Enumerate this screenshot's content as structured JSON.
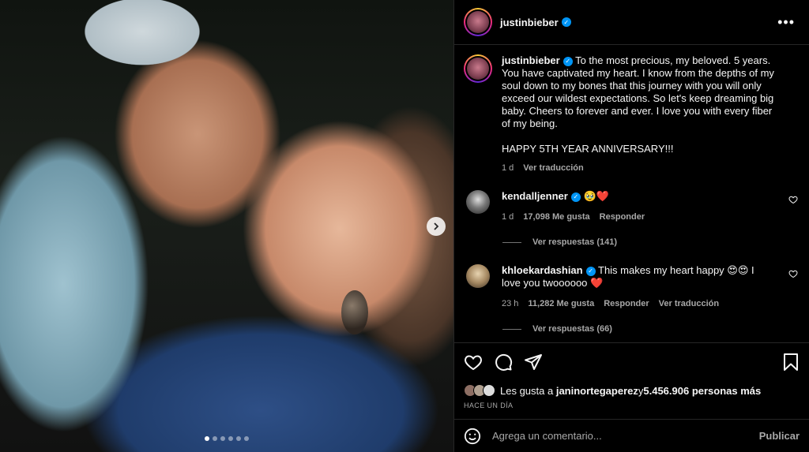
{
  "post": {
    "author": "justinbieber",
    "header_avatar_icon": "profile-avatar",
    "more_label": "•••"
  },
  "photo": {
    "carousel_dots": 6,
    "active_dot": 0,
    "next_icon": "chevron-right-icon"
  },
  "caption": {
    "username": "justinbieber",
    "text": "To the most precious, my beloved. 5 years. You have captivated my heart. I know from the depths of my soul down to my bones that this journey with you will only exceed our wildest expectations. So let's keep dreaming big baby. Cheers to forever and ever. I love you with every fiber of my being.",
    "text2": "HAPPY 5TH YEAR ANNIVERSARY!!!",
    "time": "1 d",
    "translate": "Ver traducción"
  },
  "comments": [
    {
      "username": "kendalljenner",
      "text": "🥹❤️",
      "time": "1 d",
      "likes": "17,098 Me gusta",
      "reply": "Responder",
      "replies_label": "Ver respuestas (141)"
    },
    {
      "username": "khloekardashian",
      "text": "This makes my heart happy 😍😍 I love you twoooooo ❤️",
      "time": "23 h",
      "likes": "11,282 Me gusta",
      "reply": "Responder",
      "translate": "Ver traducción",
      "replies_label": "Ver respuestas (66)"
    }
  ],
  "likes": {
    "prefix": "Les gusta a ",
    "user": "janinortegaperez",
    "middle": " y ",
    "count": "5.456.906 personas más"
  },
  "when": "HACE UN DÍA",
  "add_comment": {
    "placeholder": "Agrega un comentario...",
    "publish": "Publicar"
  },
  "colors": {
    "verified": "#0095f6",
    "heart": "#ed4956",
    "background": "#000000",
    "secondary_text": "#a8a8a8"
  }
}
